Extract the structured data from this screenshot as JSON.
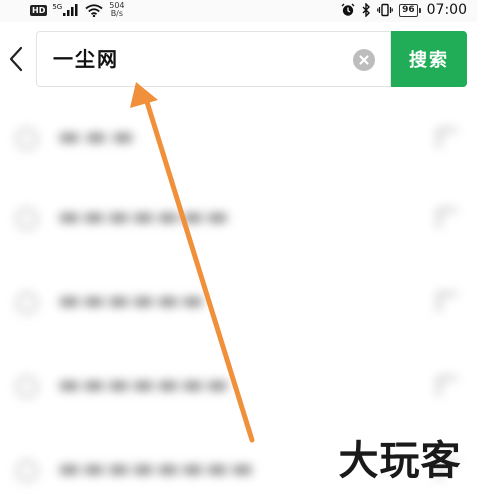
{
  "status_bar": {
    "hd_badge": "HD",
    "network_type": "5G",
    "speed_value": "504",
    "speed_unit": "B/s",
    "battery_level": "96",
    "time": "07:00"
  },
  "search": {
    "query": "一尘网",
    "button_label": "搜索"
  },
  "suggestions": [
    {
      "icon": "history-icon"
    },
    {
      "icon": "history-icon"
    },
    {
      "icon": "history-icon"
    },
    {
      "icon": "history-icon"
    },
    {
      "icon": "history-icon"
    }
  ],
  "annotation": {
    "arrow_color": "#f0903a"
  },
  "watermark": {
    "text": "大玩客"
  },
  "colors": {
    "accent": "#21ad58"
  }
}
